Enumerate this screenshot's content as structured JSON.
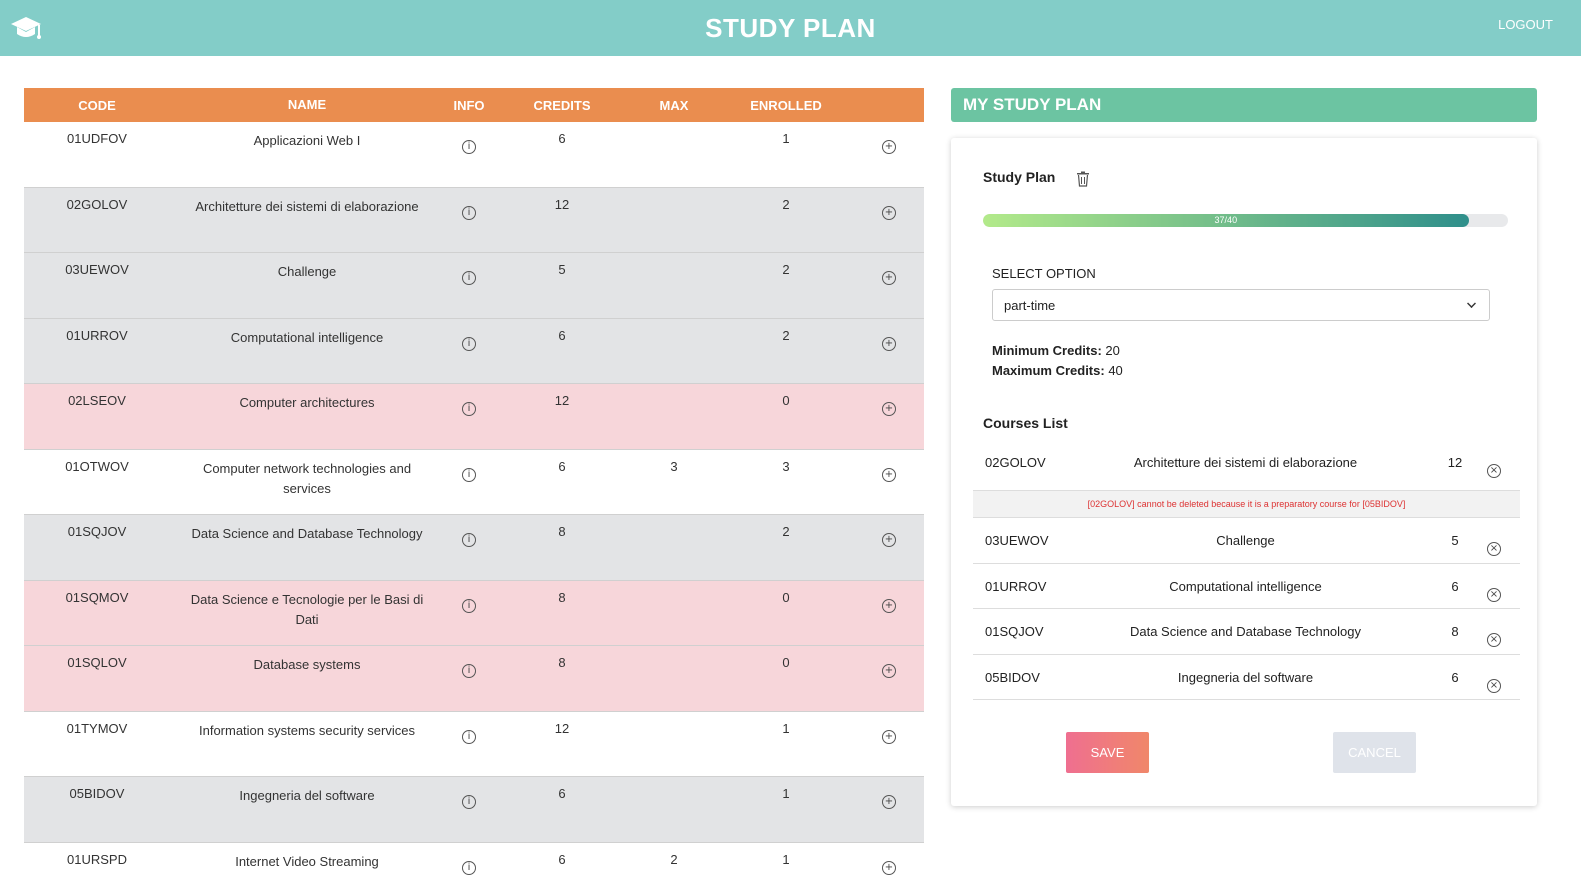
{
  "header": {
    "title": "STUDY PLAN",
    "logout": "LOGOUT"
  },
  "table": {
    "columns": [
      "CODE",
      "NAME",
      "INFO",
      "CREDITS",
      "MAX",
      "ENROLLED"
    ],
    "rows": [
      {
        "code": "01UDFOV",
        "name": "Applicazioni Web I",
        "credits": "6",
        "max": "",
        "enrolled": "1",
        "status": "white"
      },
      {
        "code": "02GOLOV",
        "name": "Architetture dei sistemi di elaborazione",
        "credits": "12",
        "max": "",
        "enrolled": "2",
        "status": "gray"
      },
      {
        "code": "03UEWOV",
        "name": "Challenge",
        "credits": "5",
        "max": "",
        "enrolled": "2",
        "status": "gray"
      },
      {
        "code": "01URROV",
        "name": "Computational intelligence",
        "credits": "6",
        "max": "",
        "enrolled": "2",
        "status": "gray"
      },
      {
        "code": "02LSEOV",
        "name": "Computer architectures",
        "credits": "12",
        "max": "",
        "enrolled": "0",
        "status": "pink"
      },
      {
        "code": "01OTWOV",
        "name": "Computer network technologies and services",
        "credits": "6",
        "max": "3",
        "enrolled": "3",
        "status": "white"
      },
      {
        "code": "01SQJOV",
        "name": "Data Science and Database Technology",
        "credits": "8",
        "max": "",
        "enrolled": "2",
        "status": "gray"
      },
      {
        "code": "01SQMOV",
        "name": "Data Science e Tecnologie per le Basi di Dati",
        "credits": "8",
        "max": "",
        "enrolled": "0",
        "status": "pink"
      },
      {
        "code": "01SQLOV",
        "name": "Database systems",
        "credits": "8",
        "max": "",
        "enrolled": "0",
        "status": "pink"
      },
      {
        "code": "01TYMOV",
        "name": "Information systems security services",
        "credits": "12",
        "max": "",
        "enrolled": "1",
        "status": "white"
      },
      {
        "code": "05BIDOV",
        "name": "Ingegneria del software",
        "credits": "6",
        "max": "",
        "enrolled": "1",
        "status": "gray"
      },
      {
        "code": "01URSPD",
        "name": "Internet Video Streaming",
        "credits": "6",
        "max": "2",
        "enrolled": "1",
        "status": "white"
      }
    ]
  },
  "plan": {
    "header": "MY STUDY PLAN",
    "label": "Study Plan",
    "progress_text": "37/40",
    "progress_fraction": 0.925,
    "select_label": "SELECT OPTION",
    "select_value": "part-time",
    "min_label": "Minimum Credits:",
    "min_value": "20",
    "max_label": "Maximum Credits:",
    "max_value": "40",
    "courses_label": "Courses List",
    "courses": [
      {
        "code": "02GOLOV",
        "name": "Architetture dei sistemi di elaborazione",
        "credits": "12"
      },
      {
        "code": "03UEWOV",
        "name": "Challenge",
        "credits": "5"
      },
      {
        "code": "01URROV",
        "name": "Computational intelligence",
        "credits": "6"
      },
      {
        "code": "01SQJOV",
        "name": "Data Science and Database Technology",
        "credits": "8"
      },
      {
        "code": "05BIDOV",
        "name": "Ingegneria del software",
        "credits": "6"
      }
    ],
    "warning": "[02GOLOV] cannot be deleted because it is a preparatory course for [05BIDOV]",
    "save": "SAVE",
    "cancel": "CANCEL"
  },
  "icons": {
    "info": "info-circle-icon",
    "add": "plus-circle-icon",
    "remove": "x-circle-icon",
    "trash": "trash-icon",
    "logo": "graduation-cap-icon"
  },
  "colors": {
    "topbar": "#83cdc8",
    "table_header": "#ea8d4f",
    "plan_header": "#6cc4a2",
    "row_gray": "#e3e4e6",
    "row_pink": "#f7d6da"
  }
}
